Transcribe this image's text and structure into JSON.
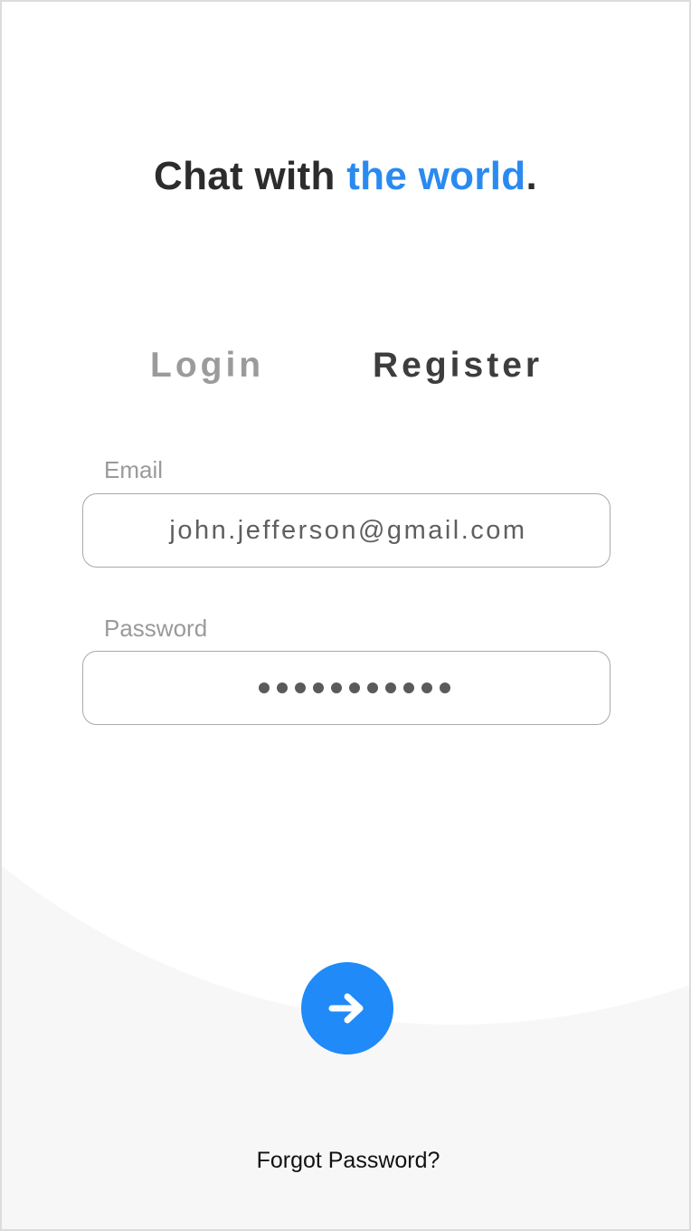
{
  "headline": {
    "prefix": "Chat with ",
    "highlight": "the world",
    "suffix": "."
  },
  "tabs": {
    "login": "Login",
    "register": "Register",
    "active": "register"
  },
  "form": {
    "email": {
      "label": "Email",
      "value": "john.jefferson@gmail.com"
    },
    "password": {
      "label": "Password",
      "masked_value": "●●●●●●●●●●●",
      "masked_length": 11
    }
  },
  "submit": {
    "icon": "arrow-right-icon"
  },
  "forgot_password_link": "Forgot Password?",
  "colors": {
    "accent": "#2a8af0",
    "button": "#1f8af8",
    "background": "#f7f7f7",
    "panel": "#ffffff",
    "text_dark": "#2c2c2c",
    "text_muted": "#9b9b9b"
  }
}
